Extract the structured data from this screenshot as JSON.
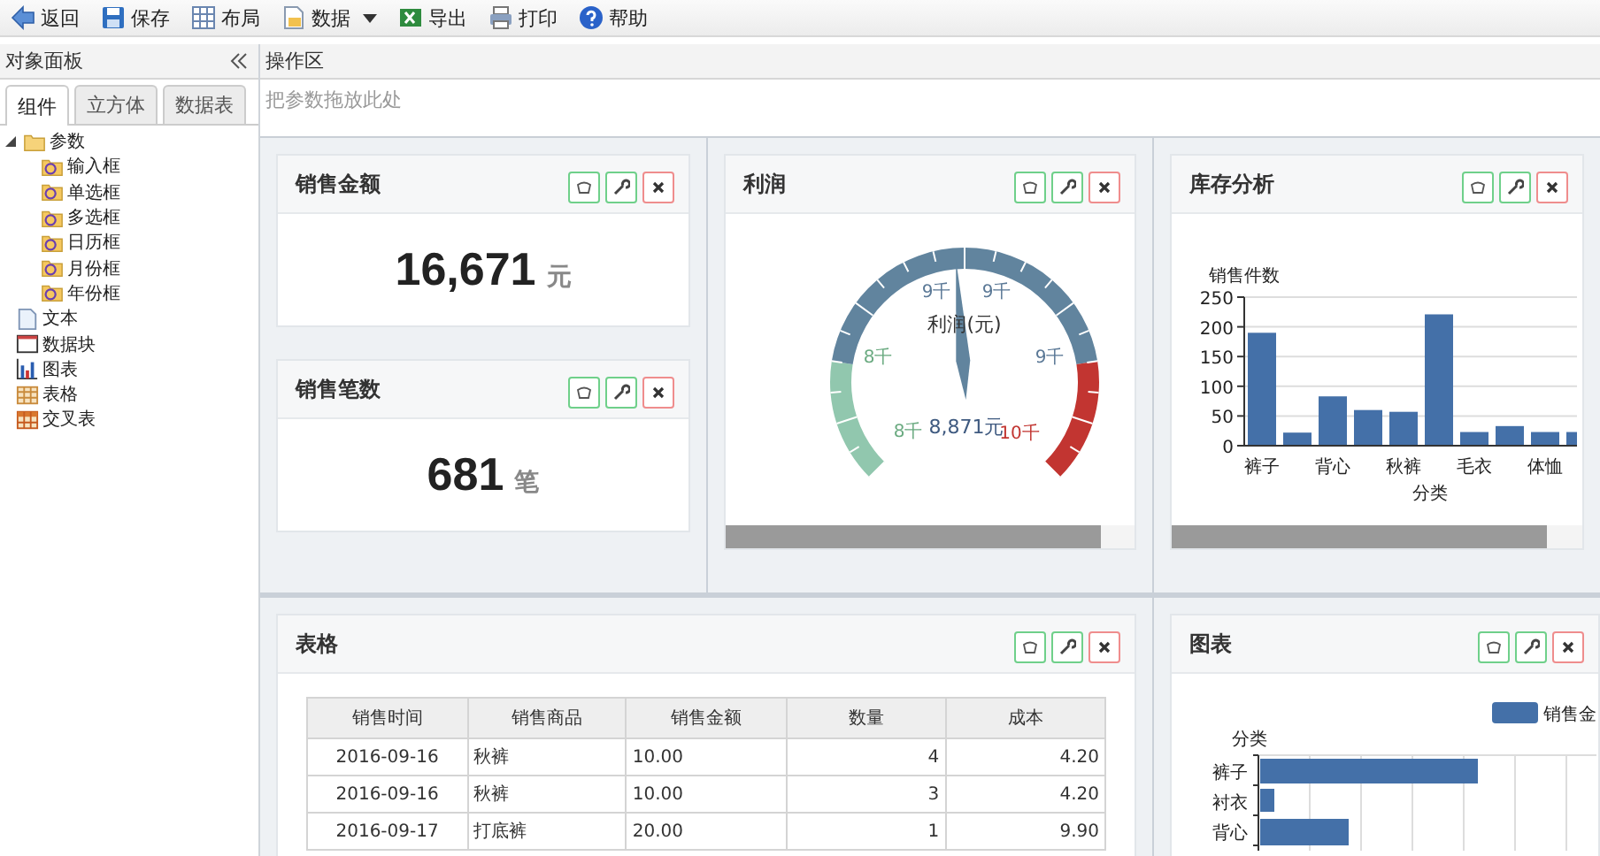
{
  "toolbar": [
    {
      "label": "返回",
      "kind": "back",
      "dropdown": false
    },
    {
      "label": "保存",
      "kind": "save",
      "dropdown": false
    },
    {
      "label": "布局",
      "kind": "layout",
      "dropdown": false
    },
    {
      "label": "数据",
      "kind": "data",
      "dropdown": true
    },
    {
      "label": "导出",
      "kind": "export",
      "dropdown": false
    },
    {
      "label": "打印",
      "kind": "print",
      "dropdown": false
    },
    {
      "label": "帮助",
      "kind": "help",
      "dropdown": false
    }
  ],
  "left_panel": {
    "title": "对象面板",
    "tabs": [
      {
        "label": "组件",
        "selected": true
      },
      {
        "label": "立方体",
        "selected": false
      },
      {
        "label": "数据表",
        "selected": false
      }
    ],
    "tree": [
      {
        "label": "参数",
        "kind": "folder",
        "expanded": true,
        "children": [
          {
            "label": "输入框",
            "kind": "param"
          },
          {
            "label": "单选框",
            "kind": "param"
          },
          {
            "label": "多选框",
            "kind": "param"
          },
          {
            "label": "日历框",
            "kind": "param"
          },
          {
            "label": "月份框",
            "kind": "param"
          },
          {
            "label": "年份框",
            "kind": "param"
          }
        ]
      },
      {
        "label": "文本",
        "kind": "text"
      },
      {
        "label": "数据块",
        "kind": "block"
      },
      {
        "label": "图表",
        "kind": "chart"
      },
      {
        "label": "表格",
        "kind": "table"
      },
      {
        "label": "交叉表",
        "kind": "crosstab"
      }
    ]
  },
  "workspace": {
    "title": "操作区",
    "placeholder": "把参数拖放此处",
    "widgets": [
      {
        "title": "销售金额",
        "kind": "metric",
        "value": "16,671",
        "unit": "元"
      },
      {
        "title": "销售笔数",
        "kind": "metric",
        "value": "681",
        "unit": "笔"
      },
      {
        "title": "利润",
        "kind": "gauge",
        "level": 0.485,
        "caption": "利润(元)",
        "reading": "8,871元",
        "labels": [
          {
            "text": "9千",
            "color": "#5a7896"
          },
          {
            "text": "9千",
            "color": "#5a7896"
          },
          {
            "text": "8千",
            "color": "#6aaa80"
          },
          {
            "text": "9千",
            "color": "#5a7896"
          },
          {
            "text": "8千",
            "color": "#6aaa80"
          },
          {
            "text": "10千",
            "color": "#c23531"
          }
        ]
      },
      {
        "title": "库存分析",
        "kind": "bar_chart",
        "chart_data": {
          "type": "bar",
          "xlabel": "分类",
          "ylabel": "销售件数",
          "categories": [
            "裤子",
            null,
            "背心",
            null,
            "秋裤",
            null,
            "毛衣",
            null,
            "体恤",
            null
          ],
          "values": [
            190,
            22,
            83,
            60,
            57,
            221,
            23,
            33,
            23,
            23
          ],
          "yticks": [
            0,
            50,
            100,
            150,
            200,
            250
          ],
          "ylim": [
            0,
            250
          ],
          "grid": true
        }
      },
      {
        "title": "表格",
        "kind": "table",
        "columns": [
          "销售时间",
          "销售商品",
          "销售金额",
          "数量",
          "成本"
        ],
        "rows": [
          [
            "2016-09-16",
            "秋裤",
            "10.00",
            "4",
            "4.20"
          ],
          [
            "2016-09-16",
            "秋裤",
            "10.00",
            "3",
            "4.20"
          ],
          [
            "2016-09-17",
            "打底裤",
            "20.00",
            "1",
            "9.90"
          ]
        ]
      },
      {
        "title": "图表",
        "kind": "hbar_chart",
        "legend": "销售金",
        "axis_label": "分类",
        "categories": [
          "裤子",
          "衬衣",
          "背心"
        ]
      }
    ]
  }
}
